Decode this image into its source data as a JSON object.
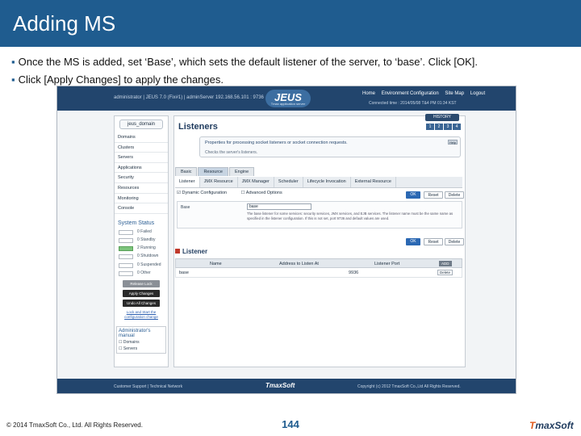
{
  "slide": {
    "title": "Adding MS",
    "bullet1": "Once the MS is added, set ‘Base’, which sets the default listener of the server, to ‘base’. Click [OK].",
    "bullet2": "Click [Apply Changes] to apply the changes.",
    "copyright": "© 2014 TmaxSoft Co., Ltd. All Rights Reserved.",
    "page_number": "144",
    "brand_prefix": "T",
    "brand_rest": "maxSoft"
  },
  "app": {
    "logo": "JEUS",
    "logo_sub": "Tmax application server",
    "top_info": "administrator  |  JEUS 7.0 (Fix#1)  |  adminServer 192.168.56.101 : 9736",
    "nav": [
      "Home",
      "Environment Configuration",
      "Site Map",
      "Logout"
    ],
    "connected": "Connected time : 2014/05/08 T&4 PM 01:34 KST",
    "history_button": "HISTORY",
    "mini_icons": [
      "1",
      "2",
      "3",
      "4"
    ],
    "footer_left": "Customer Support  |  Technical Network",
    "footer_mid": "TmaxSoft",
    "footer_right": "Copyright (c) 2012 TmaxSoft Co.,Ltd All Rights Reserved."
  },
  "sidebar": {
    "domain_button": "jeus_domain",
    "menu": [
      "Domains",
      "Clusters",
      "Servers",
      "Applications",
      "Security",
      "Resources",
      "Monitoring",
      "Console"
    ],
    "status_title": "System Status",
    "status_items": [
      {
        "label": "0 Failed",
        "green": false
      },
      {
        "label": "0 Standby",
        "green": false
      },
      {
        "label": "2 Running",
        "green": true
      },
      {
        "label": "0 Shutdown",
        "green": false
      },
      {
        "label": "0 Suspended",
        "green": false
      },
      {
        "label": "0 Other",
        "green": false
      }
    ],
    "lock_button": "Release Lock",
    "apply_button": "Apply Changes",
    "undo_button": "Undo All Changes",
    "undo_link": "Lock and Start the configuration change",
    "admin_title": "Administrator's manual",
    "admin_items": [
      "Domains",
      "Servers"
    ]
  },
  "main": {
    "title": "Listeners",
    "desc1": "Properties for processing socket listeners or socket connection requests.",
    "desc2": "Checks the server's listeners.",
    "help": "Help",
    "tabs1": [
      "Basic",
      "Resource",
      "Engine"
    ],
    "tabs2": [
      "Listener",
      "JMX Resource",
      "JMX Manager",
      "Scheduler",
      "Lifecycle Invocation",
      "External Resource"
    ],
    "opt_dynamic": "Dynamic Configuration",
    "opt_advanced": "Advanced Options",
    "ok_label": "OK",
    "reset_label": "Reset",
    "delete_label": "Delete",
    "base_label": "Base",
    "base_value": "base",
    "base_note": "The base listener for some services: security services, JMX services, and EJB services. The listener name must be the same name as specified in the listener configuration. If this is not set, port 9736 and default values are used.",
    "listener_title": "Listener",
    "table_headers": [
      "Name",
      "Address to Listen At",
      "Listener Port"
    ],
    "add_button": "ADD",
    "row": {
      "name": "base",
      "address": "",
      "port": "9936"
    },
    "row_delete": "Delete"
  }
}
